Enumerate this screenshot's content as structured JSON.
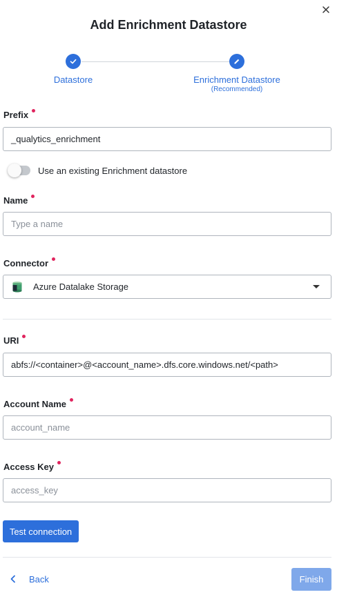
{
  "dialog": {
    "title": "Add Enrichment Datastore",
    "close_icon": "close-icon"
  },
  "stepper": {
    "steps": [
      {
        "label": "Datastore",
        "sublabel": "",
        "state": "completed",
        "icon": "check-icon"
      },
      {
        "label": "Enrichment Datastore",
        "sublabel": "(Recommended)",
        "state": "active",
        "icon": "pencil-icon"
      }
    ]
  },
  "form": {
    "prefix": {
      "label": "Prefix",
      "required": true,
      "value": "_qualytics_enrichment"
    },
    "use_existing": {
      "label": "Use an existing Enrichment datastore",
      "checked": false
    },
    "name": {
      "label": "Name",
      "required": true,
      "value": "",
      "placeholder": "Type a name"
    },
    "connector": {
      "label": "Connector",
      "required": true,
      "value": "Azure Datalake Storage",
      "icon": "azure-datalake-icon"
    },
    "uri": {
      "label": "URI",
      "required": true,
      "value": "abfs://<container>@<account_name>.dfs.core.windows.net/<path>"
    },
    "account_name": {
      "label": "Account Name",
      "required": true,
      "value": "",
      "placeholder": "account_name"
    },
    "access_key": {
      "label": "Access Key",
      "required": true,
      "value": "",
      "placeholder": "access_key"
    }
  },
  "actions": {
    "test_connection": "Test connection",
    "back": "Back",
    "finish": "Finish",
    "finish_enabled": false
  },
  "colors": {
    "primary": "#2d6fdb",
    "primary_disabled": "#7fa8ea",
    "required_dot": "#e0245e"
  }
}
